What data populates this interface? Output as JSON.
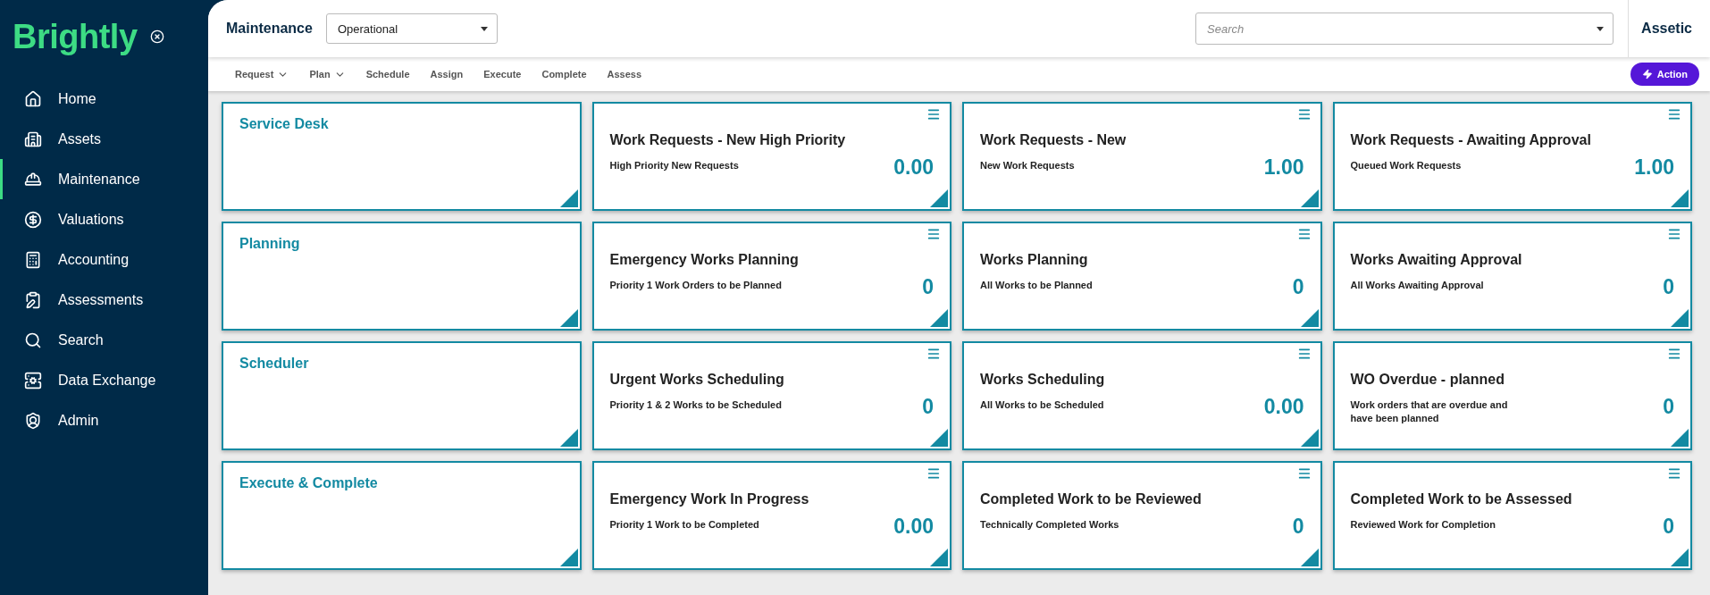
{
  "sidebar": {
    "logo": "Brightly",
    "items": [
      {
        "label": "Home",
        "selected": false
      },
      {
        "label": "Assets",
        "selected": false
      },
      {
        "label": "Maintenance",
        "selected": true
      },
      {
        "label": "Valuations",
        "selected": false
      },
      {
        "label": "Accounting",
        "selected": false
      },
      {
        "label": "Assessments",
        "selected": false
      },
      {
        "label": "Search",
        "selected": false
      },
      {
        "label": "Data Exchange",
        "selected": false
      },
      {
        "label": "Admin",
        "selected": false
      }
    ]
  },
  "header": {
    "title": "Maintenance",
    "view_select": {
      "value": "Operational"
    },
    "search": {
      "placeholder": "Search"
    },
    "brand": "Assetic"
  },
  "nav": {
    "items": [
      {
        "label": "Request",
        "dropdown": true
      },
      {
        "label": "Plan",
        "dropdown": true
      },
      {
        "label": "Schedule",
        "dropdown": false
      },
      {
        "label": "Assign",
        "dropdown": false
      },
      {
        "label": "Execute",
        "dropdown": false
      },
      {
        "label": "Complete",
        "dropdown": false
      },
      {
        "label": "Assess",
        "dropdown": false
      }
    ],
    "action": "Action"
  },
  "rows": [
    {
      "section": "Service Desk",
      "tiles": [
        {
          "title": "Work Requests - New High Priority",
          "subtitle": "High Priority New Requests",
          "value": "0.00"
        },
        {
          "title": "Work Requests - New",
          "subtitle": "New Work Requests",
          "value": "1.00"
        },
        {
          "title": "Work Requests - Awaiting Approval",
          "subtitle": "Queued Work Requests",
          "value": "1.00"
        }
      ]
    },
    {
      "section": "Planning",
      "tiles": [
        {
          "title": "Emergency Works Planning",
          "subtitle": "Priority 1 Work Orders to be Planned",
          "value": "0"
        },
        {
          "title": "Works Planning",
          "subtitle": "All Works to be Planned",
          "value": "0"
        },
        {
          "title": "Works Awaiting Approval",
          "subtitle": "All Works Awaiting Approval",
          "value": "0"
        }
      ]
    },
    {
      "section": "Scheduler",
      "tiles": [
        {
          "title": "Urgent Works Scheduling",
          "subtitle": "Priority 1 & 2 Works to be Scheduled",
          "value": "0"
        },
        {
          "title": "Works Scheduling",
          "subtitle": "All Works to be Scheduled",
          "value": "0.00"
        },
        {
          "title": "WO Overdue - planned",
          "subtitle": "Work orders that are overdue and have been planned",
          "value": "0"
        }
      ]
    },
    {
      "section": "Execute & Complete",
      "tiles": [
        {
          "title": "Emergency Work In Progress",
          "subtitle": "Priority 1 Work to be Completed",
          "value": "0.00"
        },
        {
          "title": "Completed Work to be Reviewed",
          "subtitle": "Technically Completed Works",
          "value": "0"
        },
        {
          "title": "Completed Work to be Assessed",
          "subtitle": "Reviewed Work for Completion",
          "value": "0"
        }
      ]
    }
  ]
}
